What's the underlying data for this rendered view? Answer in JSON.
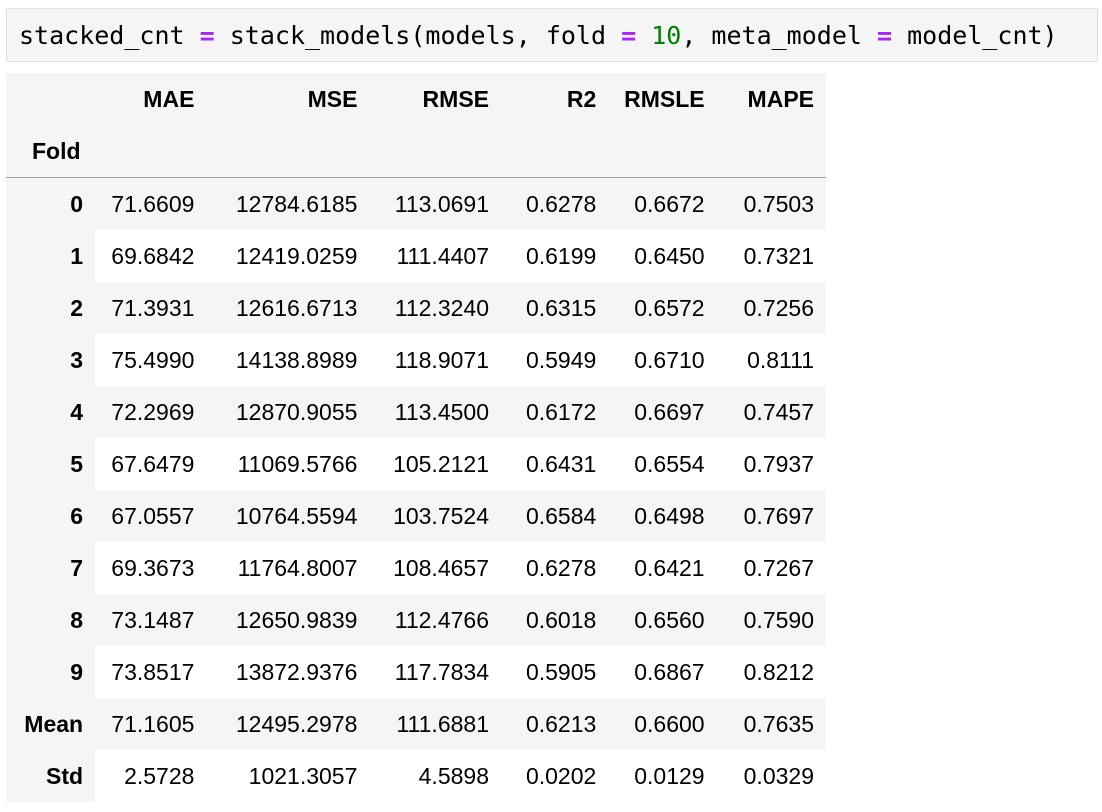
{
  "code_cell": {
    "tokens": [
      {
        "text": "stacked_cnt ",
        "kind": "name"
      },
      {
        "text": "=",
        "kind": "op"
      },
      {
        "text": " stack_models(models, fold ",
        "kind": "name"
      },
      {
        "text": "=",
        "kind": "op"
      },
      {
        "text": " ",
        "kind": "name"
      },
      {
        "text": "10",
        "kind": "num"
      },
      {
        "text": ", meta_model ",
        "kind": "name"
      },
      {
        "text": "=",
        "kind": "op"
      },
      {
        "text": " model_cnt)",
        "kind": "name"
      }
    ]
  },
  "table": {
    "columns": [
      "MAE",
      "MSE",
      "RMSE",
      "R2",
      "RMSLE",
      "MAPE"
    ],
    "index_name": "Fold",
    "rows": [
      {
        "label": "0",
        "values": [
          "71.6609",
          "12784.6185",
          "113.0691",
          "0.6278",
          "0.6672",
          "0.7503"
        ]
      },
      {
        "label": "1",
        "values": [
          "69.6842",
          "12419.0259",
          "111.4407",
          "0.6199",
          "0.6450",
          "0.7321"
        ]
      },
      {
        "label": "2",
        "values": [
          "71.3931",
          "12616.6713",
          "112.3240",
          "0.6315",
          "0.6572",
          "0.7256"
        ]
      },
      {
        "label": "3",
        "values": [
          "75.4990",
          "14138.8989",
          "118.9071",
          "0.5949",
          "0.6710",
          "0.8111"
        ]
      },
      {
        "label": "4",
        "values": [
          "72.2969",
          "12870.9055",
          "113.4500",
          "0.6172",
          "0.6697",
          "0.7457"
        ]
      },
      {
        "label": "5",
        "values": [
          "67.6479",
          "11069.5766",
          "105.2121",
          "0.6431",
          "0.6554",
          "0.7937"
        ]
      },
      {
        "label": "6",
        "values": [
          "67.0557",
          "10764.5594",
          "103.7524",
          "0.6584",
          "0.6498",
          "0.7697"
        ]
      },
      {
        "label": "7",
        "values": [
          "69.3673",
          "11764.8007",
          "108.4657",
          "0.6278",
          "0.6421",
          "0.7267"
        ]
      },
      {
        "label": "8",
        "values": [
          "73.1487",
          "12650.9839",
          "112.4766",
          "0.6018",
          "0.6560",
          "0.7590"
        ]
      },
      {
        "label": "9",
        "values": [
          "73.8517",
          "13872.9376",
          "117.7834",
          "0.5905",
          "0.6867",
          "0.8212"
        ]
      },
      {
        "label": "Mean",
        "values": [
          "71.1605",
          "12495.2978",
          "111.6881",
          "0.6213",
          "0.6600",
          "0.7635"
        ]
      },
      {
        "label": "Std",
        "values": [
          "2.5728",
          "1021.3057",
          "4.5898",
          "0.0202",
          "0.0129",
          "0.0329"
        ]
      }
    ]
  },
  "colors": {
    "code_operator": "#aa22ff",
    "code_number": "#008000",
    "stripe": "#f5f5f5",
    "header_bg": "#f5f5f5"
  }
}
